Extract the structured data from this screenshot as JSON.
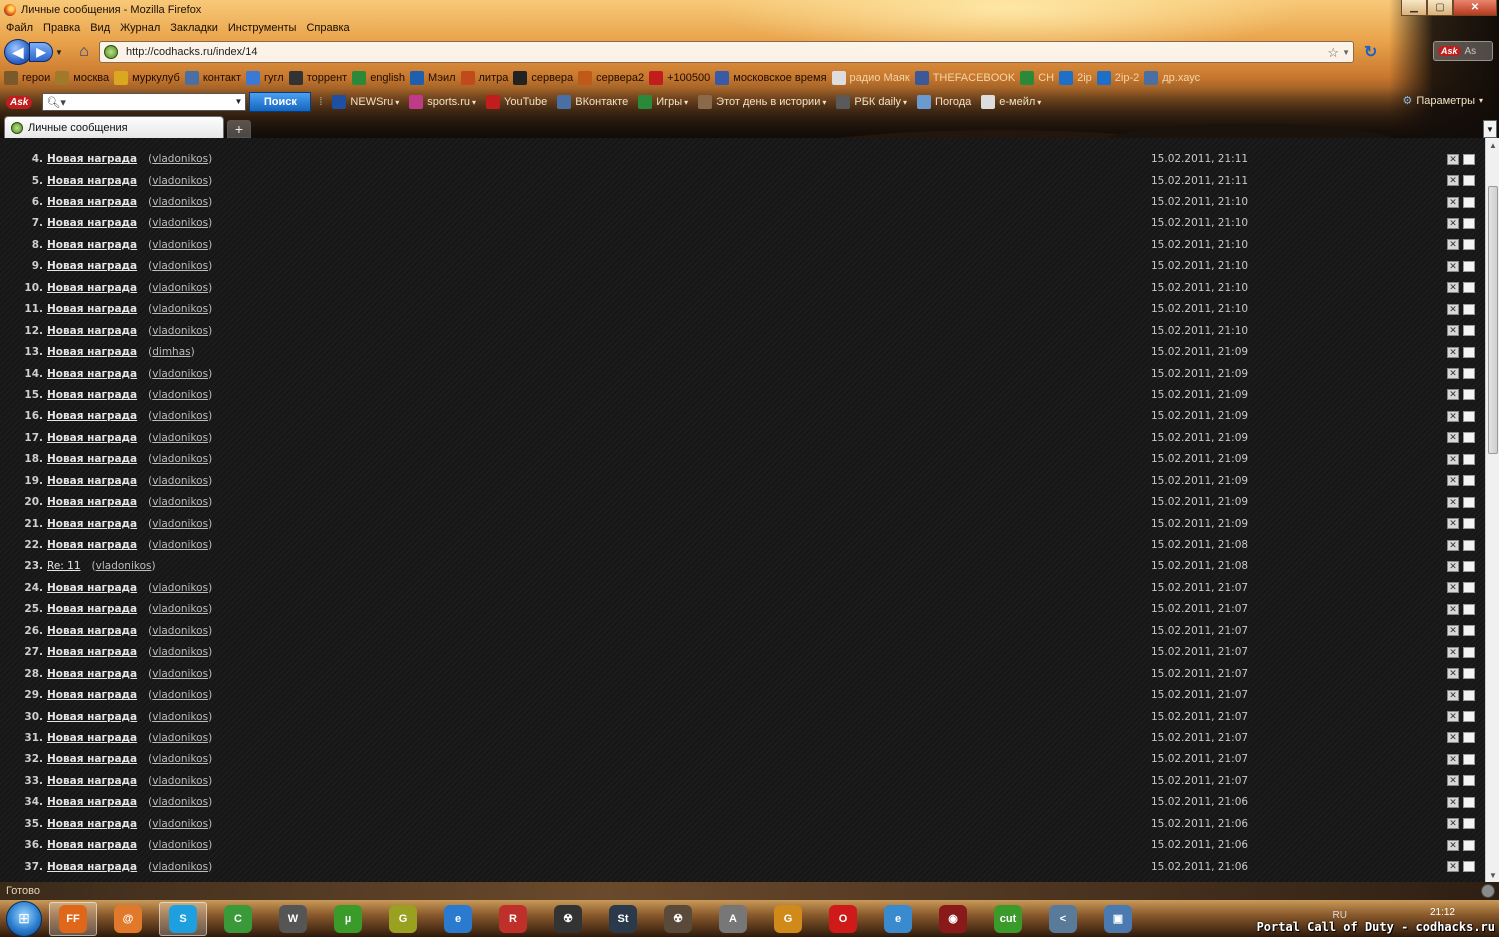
{
  "window": {
    "title": "Личные сообщения - Mozilla Firefox",
    "buttons": {
      "minimize": "▁",
      "maximize": "▢",
      "close": "✕"
    }
  },
  "menu": [
    "Файл",
    "Правка",
    "Вид",
    "Журнал",
    "Закладки",
    "Инструменты",
    "Справка"
  ],
  "navigation": {
    "url": "http://codhacks.ru/index/14",
    "search_engine_hint": "As"
  },
  "bookmarks": [
    {
      "label": "герои",
      "icon": "heroes-icon",
      "color": "#7a5a2a"
    },
    {
      "label": "москва",
      "icon": "moscow-icon",
      "color": "#a07a2a"
    },
    {
      "label": "муркулуб",
      "icon": "folder-icon",
      "color": "#d9a720"
    },
    {
      "label": "контакт",
      "icon": "vk-icon",
      "color": "#4a6fa5"
    },
    {
      "label": "гугл",
      "icon": "google-icon",
      "color": "#3a7ad6"
    },
    {
      "label": "торрент",
      "icon": "torrent-icon",
      "color": "#333333"
    },
    {
      "label": "english",
      "icon": "english-icon",
      "color": "#2a8a3a"
    },
    {
      "label": "Мэил",
      "icon": "mail-icon",
      "color": "#1e5fb0"
    },
    {
      "label": "литра",
      "icon": "book-icon",
      "color": "#c04a1a"
    },
    {
      "label": "сервера",
      "icon": "server-icon",
      "color": "#222222"
    },
    {
      "label": "сервера2",
      "icon": "server2-icon",
      "color": "#c05a1a"
    },
    {
      "label": "+100500",
      "icon": "youtube-icon",
      "color": "#c21d1d"
    },
    {
      "label": "московское время",
      "icon": "clock-icon",
      "color": "#3a5aa8"
    },
    {
      "label": "радио Маяк",
      "icon": "page-icon",
      "color": "#dddddd"
    },
    {
      "label": "THEFACEBOOK",
      "icon": "facebook-icon",
      "color": "#3b5998"
    },
    {
      "label": "CH",
      "icon": "ch-icon",
      "color": "#2a8a3a"
    },
    {
      "label": "2ip",
      "icon": "ip-icon",
      "color": "#1e6fc8"
    },
    {
      "label": "2ip-2",
      "icon": "ip2-icon",
      "color": "#1e6fc8"
    },
    {
      "label": "др.хаус",
      "icon": "house-icon",
      "color": "#4a6fa5"
    }
  ],
  "ask_toolbar": {
    "logo": "Ask",
    "search_button": "Поиск",
    "items": [
      {
        "label": "NEWSru",
        "icon": "news-icon",
        "color": "#1e4fa0",
        "dropdown": true
      },
      {
        "label": "sports.ru",
        "icon": "sports-icon",
        "color": "#c03a8a",
        "dropdown": true
      },
      {
        "label": "YouTube",
        "icon": "youtube-icon",
        "color": "#c21d1d",
        "dropdown": false
      },
      {
        "label": "ВКонтакте",
        "icon": "vk-icon",
        "color": "#4a6fa5",
        "dropdown": false
      },
      {
        "label": "Игры",
        "icon": "games-icon",
        "color": "#2a8a3a",
        "dropdown": true
      },
      {
        "label": "Этот день в истории",
        "icon": "history-icon",
        "color": "#8a6a4a",
        "dropdown": true
      },
      {
        "label": "РБК daily",
        "icon": "rbk-icon",
        "color": "#5a5a5a",
        "dropdown": true
      },
      {
        "label": "Погода",
        "icon": "weather-icon",
        "color": "#6a9ad0",
        "dropdown": false
      },
      {
        "label": "e-мейл",
        "icon": "email-icon",
        "color": "#dddddd",
        "dropdown": true
      }
    ],
    "params_label": "Параметры"
  },
  "tabs": [
    {
      "label": "Личные сообщения"
    }
  ],
  "messages": [
    {
      "n": "4.",
      "subject": "Новая награда",
      "author": "vladonikos",
      "date": "15.02.2011, 21:11",
      "bold": true
    },
    {
      "n": "5.",
      "subject": "Новая награда",
      "author": "vladonikos",
      "date": "15.02.2011, 21:11",
      "bold": true
    },
    {
      "n": "6.",
      "subject": "Новая награда",
      "author": "vladonikos",
      "date": "15.02.2011, 21:10",
      "bold": true
    },
    {
      "n": "7.",
      "subject": "Новая награда",
      "author": "vladonikos",
      "date": "15.02.2011, 21:10",
      "bold": true
    },
    {
      "n": "8.",
      "subject": "Новая награда",
      "author": "vladonikos",
      "date": "15.02.2011, 21:10",
      "bold": true
    },
    {
      "n": "9.",
      "subject": "Новая награда",
      "author": "vladonikos",
      "date": "15.02.2011, 21:10",
      "bold": true
    },
    {
      "n": "10.",
      "subject": "Новая награда",
      "author": "vladonikos",
      "date": "15.02.2011, 21:10",
      "bold": true
    },
    {
      "n": "11.",
      "subject": "Новая награда",
      "author": "vladonikos",
      "date": "15.02.2011, 21:10",
      "bold": true
    },
    {
      "n": "12.",
      "subject": "Новая награда",
      "author": "vladonikos",
      "date": "15.02.2011, 21:10",
      "bold": true
    },
    {
      "n": "13.",
      "subject": "Новая награда",
      "author": "dimhas",
      "date": "15.02.2011, 21:09",
      "bold": true
    },
    {
      "n": "14.",
      "subject": "Новая награда",
      "author": "vladonikos",
      "date": "15.02.2011, 21:09",
      "bold": true
    },
    {
      "n": "15.",
      "subject": "Новая награда",
      "author": "vladonikos",
      "date": "15.02.2011, 21:09",
      "bold": true
    },
    {
      "n": "16.",
      "subject": "Новая награда",
      "author": "vladonikos",
      "date": "15.02.2011, 21:09",
      "bold": true
    },
    {
      "n": "17.",
      "subject": "Новая награда",
      "author": "vladonikos",
      "date": "15.02.2011, 21:09",
      "bold": true
    },
    {
      "n": "18.",
      "subject": "Новая награда",
      "author": "vladonikos",
      "date": "15.02.2011, 21:09",
      "bold": true
    },
    {
      "n": "19.",
      "subject": "Новая награда",
      "author": "vladonikos",
      "date": "15.02.2011, 21:09",
      "bold": true
    },
    {
      "n": "20.",
      "subject": "Новая награда",
      "author": "vladonikos",
      "date": "15.02.2011, 21:09",
      "bold": true
    },
    {
      "n": "21.",
      "subject": "Новая награда",
      "author": "vladonikos",
      "date": "15.02.2011, 21:09",
      "bold": true
    },
    {
      "n": "22.",
      "subject": "Новая награда",
      "author": "vladonikos",
      "date": "15.02.2011, 21:08",
      "bold": true
    },
    {
      "n": "23.",
      "subject": "Re: 11",
      "author": "vladonikos",
      "date": "15.02.2011, 21:08",
      "bold": false
    },
    {
      "n": "24.",
      "subject": "Новая награда",
      "author": "vladonikos",
      "date": "15.02.2011, 21:07",
      "bold": true
    },
    {
      "n": "25.",
      "subject": "Новая награда",
      "author": "vladonikos",
      "date": "15.02.2011, 21:07",
      "bold": true
    },
    {
      "n": "26.",
      "subject": "Новая награда",
      "author": "vladonikos",
      "date": "15.02.2011, 21:07",
      "bold": true
    },
    {
      "n": "27.",
      "subject": "Новая награда",
      "author": "vladonikos",
      "date": "15.02.2011, 21:07",
      "bold": true
    },
    {
      "n": "28.",
      "subject": "Новая награда",
      "author": "vladonikos",
      "date": "15.02.2011, 21:07",
      "bold": true
    },
    {
      "n": "29.",
      "subject": "Новая награда",
      "author": "vladonikos",
      "date": "15.02.2011, 21:07",
      "bold": true
    },
    {
      "n": "30.",
      "subject": "Новая награда",
      "author": "vladonikos",
      "date": "15.02.2011, 21:07",
      "bold": true
    },
    {
      "n": "31.",
      "subject": "Новая награда",
      "author": "vladonikos",
      "date": "15.02.2011, 21:07",
      "bold": true
    },
    {
      "n": "32.",
      "subject": "Новая награда",
      "author": "vladonikos",
      "date": "15.02.2011, 21:07",
      "bold": true
    },
    {
      "n": "33.",
      "subject": "Новая награда",
      "author": "vladonikos",
      "date": "15.02.2011, 21:07",
      "bold": true
    },
    {
      "n": "34.",
      "subject": "Новая награда",
      "author": "vladonikos",
      "date": "15.02.2011, 21:06",
      "bold": true
    },
    {
      "n": "35.",
      "subject": "Новая награда",
      "author": "vladonikos",
      "date": "15.02.2011, 21:06",
      "bold": true
    },
    {
      "n": "36.",
      "subject": "Новая награда",
      "author": "vladonikos",
      "date": "15.02.2011, 21:06",
      "bold": true
    },
    {
      "n": "37.",
      "subject": "Новая награда",
      "author": "vladonikos",
      "date": "15.02.2011, 21:06",
      "bold": true
    }
  ],
  "status": {
    "text": "Готово"
  },
  "taskbar": {
    "apps": [
      {
        "name": "firefox-app",
        "glyph": "FF",
        "color": "#e0661a",
        "active": true
      },
      {
        "name": "qip-app",
        "glyph": "@",
        "color": "#e07a2a",
        "active": false
      },
      {
        "name": "skype-app",
        "glyph": "S",
        "color": "#1ea0e0",
        "active": true
      },
      {
        "name": "chrome-app",
        "glyph": "C",
        "color": "#3a9a3a",
        "active": false
      },
      {
        "name": "winamp-app",
        "glyph": "W",
        "color": "#555555",
        "active": false
      },
      {
        "name": "utorrent-app",
        "glyph": "µ",
        "color": "#3a9a2a",
        "active": false
      },
      {
        "name": "game-app",
        "glyph": "G",
        "color": "#9aa020",
        "active": false
      },
      {
        "name": "ie-app",
        "glyph": "e",
        "color": "#2a7ad0",
        "active": false
      },
      {
        "name": "red-app",
        "glyph": "R",
        "color": "#c0302a",
        "active": false
      },
      {
        "name": "radiation-app",
        "glyph": "☢",
        "color": "#333333",
        "active": false
      },
      {
        "name": "steam-app",
        "glyph": "St",
        "color": "#2a3a4a",
        "active": false
      },
      {
        "name": "stalker-app",
        "glyph": "☢",
        "color": "#5a4a3a",
        "active": false
      },
      {
        "name": "assassin-app",
        "glyph": "A",
        "color": "#777777",
        "active": false
      },
      {
        "name": "g-app",
        "glyph": "G",
        "color": "#d08a1a",
        "active": false
      },
      {
        "name": "opera-app",
        "glyph": "O",
        "color": "#d01a1a",
        "active": false
      },
      {
        "name": "ie2-app",
        "glyph": "e",
        "color": "#3a8ad0",
        "active": false
      },
      {
        "name": "cod-app",
        "glyph": "◉",
        "color": "#8a1a1a",
        "active": false
      },
      {
        "name": "mp3cut-app",
        "glyph": "cut",
        "color": "#3a9a2a",
        "active": false
      },
      {
        "name": "arrow-app",
        "glyph": "<",
        "color": "#5a7a9a",
        "active": false
      },
      {
        "name": "window-app",
        "glyph": "▣",
        "color": "#4a7ab0",
        "active": false
      }
    ],
    "lang": "RU",
    "clock": "21:12"
  },
  "watermark": "Portal Call of Duty - codhacks.ru"
}
